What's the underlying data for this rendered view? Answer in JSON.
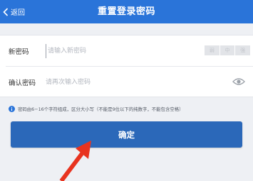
{
  "header": {
    "back_label": "返回",
    "title": "重置登录密码",
    "background_color": "#2a74d9"
  },
  "form": {
    "new_password": {
      "label": "新密码",
      "placeholder": "请输入新密码",
      "strength_levels": [
        "弱",
        "中",
        "强"
      ]
    },
    "confirm_password": {
      "label": "确认密码",
      "placeholder": "请再次输入密码",
      "icon": "eye-icon"
    }
  },
  "note": {
    "icon": "info-icon",
    "text": "密码由6−16个字符组成，区分大小写（不能是9位以下的纯数字，不能包含空格）"
  },
  "confirm_button": {
    "label": "确定",
    "color": "#2b68b9"
  },
  "annotation": {
    "icon": "red-arrow-icon",
    "color": "#e8331f"
  }
}
